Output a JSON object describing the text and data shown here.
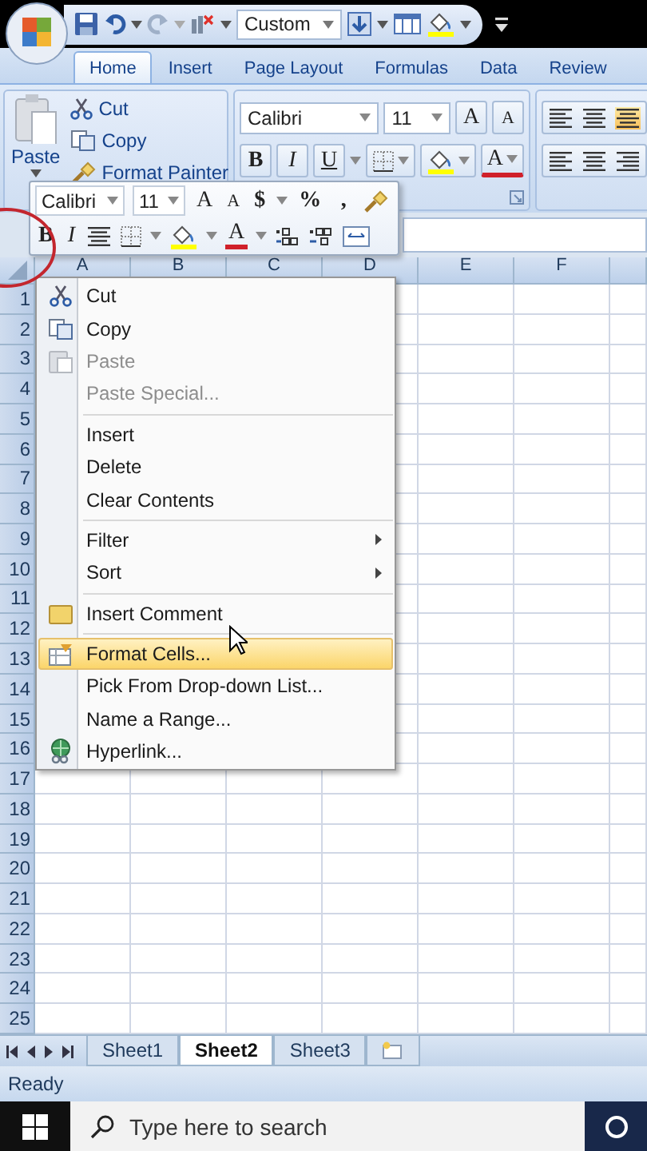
{
  "quick_access": {
    "number_format": "Custom"
  },
  "ribbon_tabs": [
    {
      "label": "Home",
      "selected": true
    },
    {
      "label": "Insert",
      "selected": false
    },
    {
      "label": "Page Layout",
      "selected": false
    },
    {
      "label": "Formulas",
      "selected": false
    },
    {
      "label": "Data",
      "selected": false
    },
    {
      "label": "Review",
      "selected": false
    }
  ],
  "clipboard": {
    "paste": "Paste",
    "cut": "Cut",
    "copy": "Copy",
    "format_painter": "Format Painter"
  },
  "font_group": {
    "font": "Calibri",
    "size": "11",
    "grow": "A",
    "shrink": "A",
    "bold": "B",
    "italic": "I",
    "underline": "U",
    "font_color": "A"
  },
  "mini_toolbar": {
    "font": "Calibri",
    "size": "11",
    "grow": "A",
    "shrink": "A",
    "currency": "$",
    "percent": "%",
    "comma": ",",
    "bold": "B",
    "italic": "I",
    "font_color": "A"
  },
  "columns": [
    "A",
    "B",
    "C",
    "D",
    "E",
    "F"
  ],
  "rows": [
    "1",
    "2",
    "3",
    "4",
    "5",
    "6",
    "7",
    "8",
    "9",
    "10",
    "11",
    "12",
    "13",
    "14",
    "15",
    "16",
    "17",
    "18",
    "19",
    "20",
    "21",
    "22",
    "23",
    "24",
    "25"
  ],
  "context_menu": [
    {
      "kind": "item",
      "label": "Cut",
      "disabled": false,
      "selected": false,
      "submenu": false
    },
    {
      "kind": "item",
      "label": "Copy",
      "disabled": false,
      "selected": false,
      "submenu": false
    },
    {
      "kind": "item",
      "label": "Paste",
      "disabled": true,
      "selected": false,
      "submenu": false
    },
    {
      "kind": "item",
      "label": "Paste Special...",
      "disabled": true,
      "selected": false,
      "submenu": false
    },
    {
      "kind": "separator"
    },
    {
      "kind": "item",
      "label": "Insert",
      "disabled": false,
      "selected": false,
      "submenu": false
    },
    {
      "kind": "item",
      "label": "Delete",
      "disabled": false,
      "selected": false,
      "submenu": false
    },
    {
      "kind": "item",
      "label": "Clear Contents",
      "disabled": false,
      "selected": false,
      "submenu": false
    },
    {
      "kind": "separator"
    },
    {
      "kind": "item",
      "label": "Filter",
      "disabled": false,
      "selected": false,
      "submenu": true
    },
    {
      "kind": "item",
      "label": "Sort",
      "disabled": false,
      "selected": false,
      "submenu": true
    },
    {
      "kind": "separator"
    },
    {
      "kind": "item",
      "label": "Insert Comment",
      "disabled": false,
      "selected": false,
      "submenu": false
    },
    {
      "kind": "separator"
    },
    {
      "kind": "item",
      "label": "Format Cells...",
      "disabled": false,
      "selected": true,
      "submenu": false
    },
    {
      "kind": "item",
      "label": "Pick From Drop-down List...",
      "disabled": false,
      "selected": false,
      "submenu": false
    },
    {
      "kind": "item",
      "label": "Name a Range...",
      "disabled": false,
      "selected": false,
      "submenu": false
    },
    {
      "kind": "item",
      "label": "Hyperlink...",
      "disabled": false,
      "selected": false,
      "submenu": false
    }
  ],
  "sheet_tabs": [
    {
      "label": "Sheet1",
      "selected": false
    },
    {
      "label": "Sheet2",
      "selected": true
    },
    {
      "label": "Sheet3",
      "selected": false
    }
  ],
  "status_bar": {
    "text": "Ready"
  },
  "taskbar": {
    "search": {
      "placeholder": "Type here to search"
    }
  }
}
